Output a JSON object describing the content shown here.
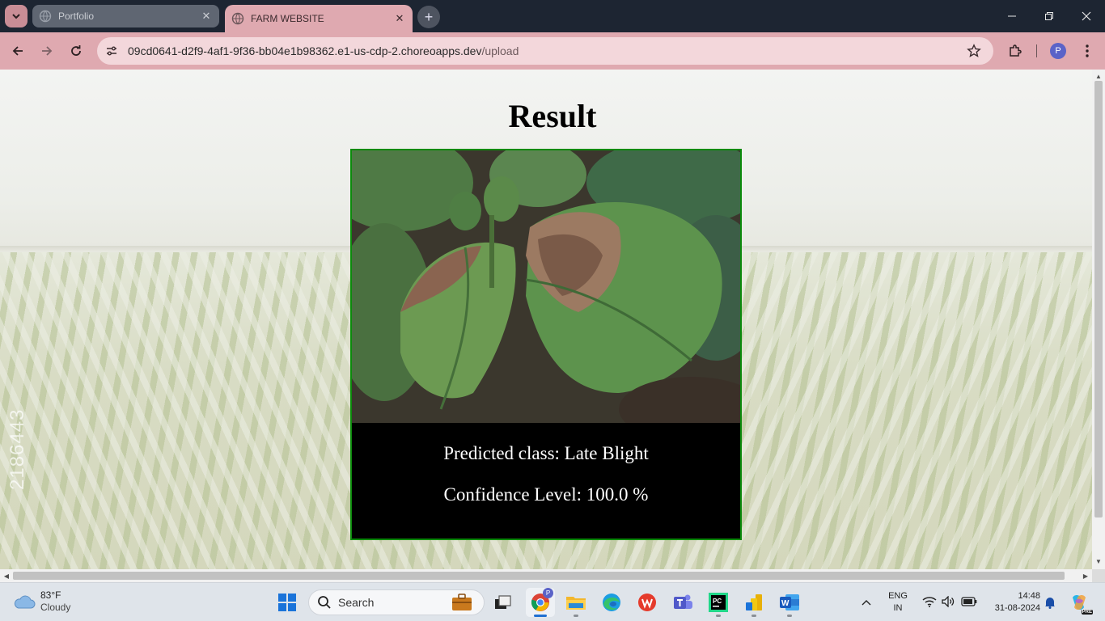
{
  "browser": {
    "tabs": [
      {
        "title": "Portfolio",
        "active": false
      },
      {
        "title": "FARM WEBSITE",
        "active": true
      }
    ],
    "address": {
      "host": "09cd0641-d2f9-4af1-9f36-bb04e1b98362.e1-us-cdp-2.choreoapps.dev",
      "path": "/upload"
    },
    "profile_initial": "P"
  },
  "page": {
    "title": "Result",
    "predicted_class_text": "Predicted class: Late Blight",
    "confidence_text": "Confidence Level: 100.0 %",
    "watermark": "2186443"
  },
  "taskbar": {
    "weather": {
      "temp": "83°F",
      "condition": "Cloudy"
    },
    "search_label": "Search",
    "language": {
      "line1": "ENG",
      "line2": "IN"
    },
    "time": "14:48",
    "date": "31-08-2024",
    "chrome_badge": "P",
    "copilot_badge": "PRE"
  },
  "colors": {
    "tab_strip": "#1d2532",
    "toolbar": "#dfa9b0",
    "card_border": "#0b8a0b",
    "card_bg": "#000000"
  }
}
